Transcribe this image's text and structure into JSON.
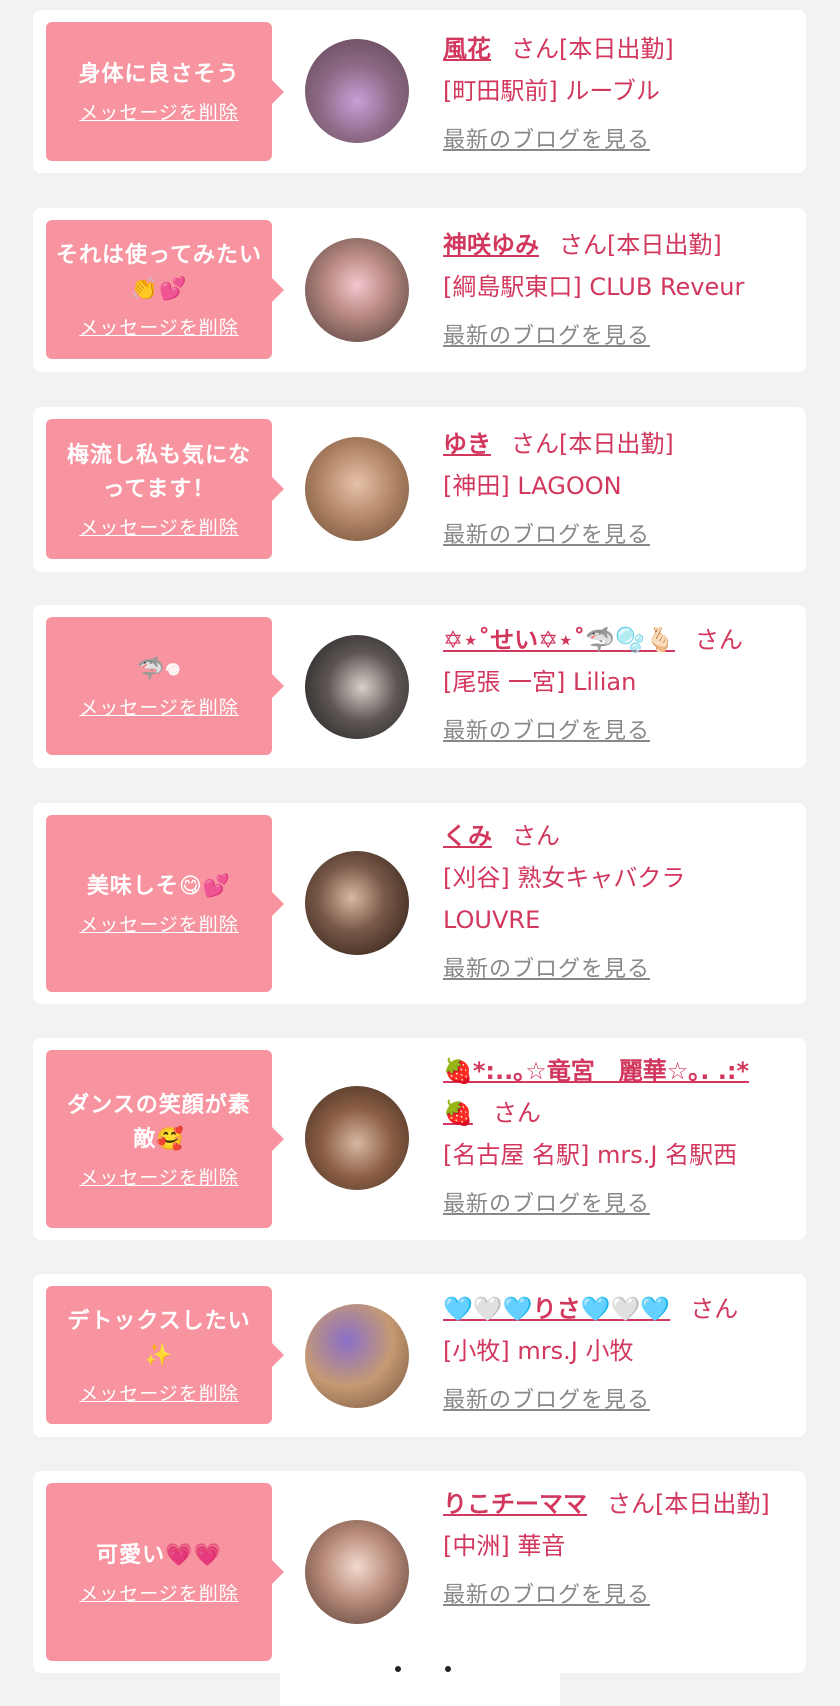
{
  "cards": [
    {
      "message": "身体に良さそう",
      "delete_label": "メッセージを削除",
      "name": "風花",
      "san": "さん",
      "status": "[本日出勤]",
      "shop": "[町田駅前] ルーブル",
      "blog_label": "最新のブログを見る"
    },
    {
      "message": "それは使ってみたい👏💕",
      "delete_label": "メッセージを削除",
      "name": "神咲ゆみ",
      "san": "さん",
      "status": "[本日出勤]",
      "shop": "[綱島駅東口] CLUB Reveur",
      "blog_label": "最新のブログを見る"
    },
    {
      "message": "梅流し私も気になってます！",
      "delete_label": "メッセージを削除",
      "name": "ゆき",
      "san": "さん",
      "status": "[本日出勤]",
      "shop": "[神田] LAGOON",
      "blog_label": "最新のブログを見る"
    },
    {
      "message": "🦈𖦹",
      "delete_label": "メッセージを削除",
      "name": "✡⋆˚せい✡⋆˚🦈🫧🫰🏻",
      "san": "さん",
      "status": "",
      "shop": "[尾張 一宮] Lilian",
      "blog_label": "最新のブログを見る"
    },
    {
      "message": "美味しそ😋💕",
      "delete_label": "メッセージを削除",
      "name": "くみ",
      "san": "さん",
      "status": "",
      "shop": "[刈谷] 熟女キャバクラLOUVRE",
      "blog_label": "最新のブログを見る"
    },
    {
      "message": "ダンスの笑顔が素敵🥰",
      "delete_label": "メッセージを削除",
      "name": "🍓*:..｡☆竜宮　麗華☆｡. .:*🍓",
      "san": "さん",
      "status": "",
      "shop": "[名古屋 名駅] mrs.J 名駅西",
      "blog_label": "最新のブログを見る"
    },
    {
      "message": "デトックスしたい✨",
      "delete_label": "メッセージを削除",
      "name": "🩵🤍🩵りさ🩵🤍🩵",
      "san": "さん",
      "status": "",
      "shop": "[小牧] mrs.J 小牧",
      "blog_label": "最新のブログを見る"
    },
    {
      "message": "可愛い💗💗",
      "delete_label": "メッセージを削除",
      "name": "りこチーママ",
      "san": "さん",
      "status": "[本日出勤]",
      "shop": "[中洲] 華音",
      "blog_label": "最新のブログを見る"
    }
  ],
  "colors": {
    "page_bg": "#f3f2f1",
    "bubble": "#f7949f",
    "accent": "#d2375d",
    "link_gray": "#888888"
  }
}
